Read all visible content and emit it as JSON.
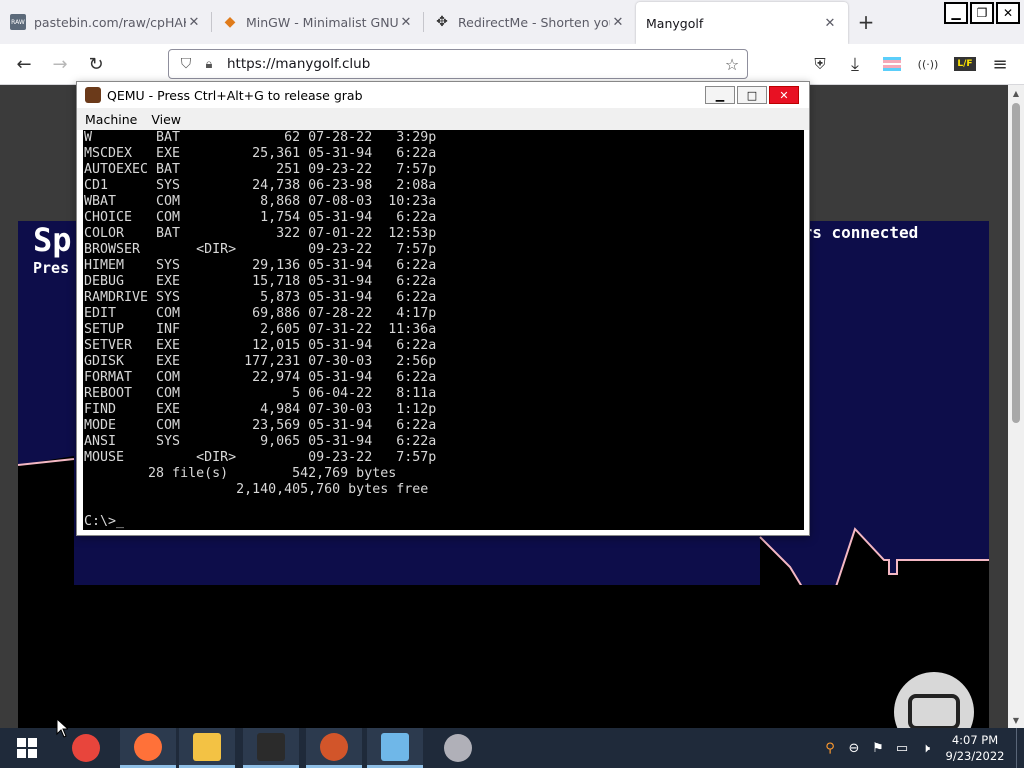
{
  "browser": {
    "tabs": [
      {
        "title": "pastebin.com/raw/cpHAKawE",
        "favicon_text": "RAW",
        "active": false
      },
      {
        "title": "MinGW - Minimalist GNU for",
        "favicon_text": "◆",
        "active": false
      },
      {
        "title": "RedirectMe - Shorten your UR",
        "favicon_text": "✥",
        "active": false
      },
      {
        "title": "Manygolf",
        "favicon_text": "",
        "active": true
      }
    ],
    "url": "https://manygolf.club",
    "colors": {
      "accent": "#f0f0f4",
      "window_close": "#e81123"
    }
  },
  "game": {
    "title_left": "Sp",
    "subtitle_left": "Pres",
    "status_right": "ers connected",
    "colors": {
      "sky": "#0d0d4a",
      "ground": "#000000",
      "line": "#f4b8c4"
    }
  },
  "qemu": {
    "title": "QEMU - Press Ctrl+Alt+G to release grab",
    "menu": [
      "Machine",
      "View"
    ],
    "lines": [
      "W        BAT             62 07-28-22   3:29p",
      "MSCDEX   EXE         25,361 05-31-94   6:22a",
      "AUTOEXEC BAT            251 09-23-22   7:57p",
      "CD1      SYS         24,738 06-23-98   2:08a",
      "WBAT     COM          8,868 07-08-03  10:23a",
      "CHOICE   COM          1,754 05-31-94   6:22a",
      "COLOR    BAT            322 07-01-22  12:53p",
      "BROWSER       <DIR>         09-23-22   7:57p",
      "HIMEM    SYS         29,136 05-31-94   6:22a",
      "DEBUG    EXE         15,718 05-31-94   6:22a",
      "RAMDRIVE SYS          5,873 05-31-94   6:22a",
      "EDIT     COM         69,886 07-28-22   4:17p",
      "SETUP    INF          2,605 07-31-22  11:36a",
      "SETVER   EXE         12,015 05-31-94   6:22a",
      "GDISK    EXE        177,231 07-30-03   2:56p",
      "FORMAT   COM         22,974 05-31-94   6:22a",
      "REBOOT   COM              5 06-04-22   8:11a",
      "FIND     EXE          4,984 07-30-03   1:12p",
      "MODE     COM         23,569 05-31-94   6:22a",
      "ANSI     SYS          9,065 05-31-94   6:22a",
      "MOUSE         <DIR>         09-23-22   7:57p",
      "        28 file(s)        542,769 bytes",
      "                   2,140,405,760 bytes free",
      "",
      "C:\\>_"
    ]
  },
  "taskbar": {
    "apps": [
      {
        "name": "chrome-icon",
        "color": "#e8453c"
      },
      {
        "name": "firefox-icon",
        "color": "#ff7139"
      },
      {
        "name": "file-explorer-icon",
        "color": "#f3c244"
      },
      {
        "name": "command-prompt-icon",
        "color": "#2b2b2b"
      },
      {
        "name": "qemu-icon",
        "color": "#d2552a"
      },
      {
        "name": "notepad-icon",
        "color": "#6fb7e8"
      },
      {
        "name": "printer-app-icon",
        "color": "#b0b0b8"
      }
    ],
    "clock_time": "4:07 PM",
    "clock_date": "9/23/2022"
  }
}
